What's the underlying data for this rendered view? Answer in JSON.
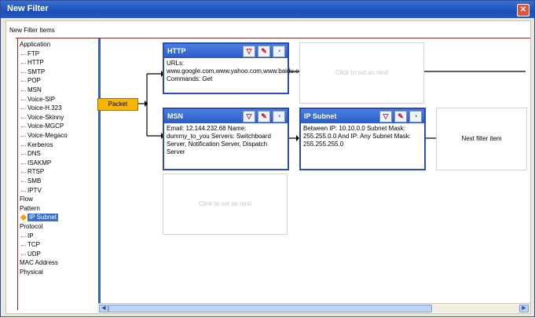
{
  "window": {
    "title": "New Filter",
    "close_glyph": "✕"
  },
  "panel": {
    "label": "New Filter Items"
  },
  "tree": [
    {
      "label": "Application",
      "level": 0
    },
    {
      "label": "FTP",
      "level": 1
    },
    {
      "label": "HTTP",
      "level": 1
    },
    {
      "label": "SMTP",
      "level": 1
    },
    {
      "label": "POP",
      "level": 1
    },
    {
      "label": "MSN",
      "level": 1
    },
    {
      "label": "Voice-SIP",
      "level": 1
    },
    {
      "label": "Voice-H.323",
      "level": 1
    },
    {
      "label": "Voice-Skinny",
      "level": 1
    },
    {
      "label": "Voice-MGCP",
      "level": 1
    },
    {
      "label": "Voice-Megaco",
      "level": 1
    },
    {
      "label": "Kerberos",
      "level": 1
    },
    {
      "label": "DNS",
      "level": 1
    },
    {
      "label": "ISAKMP",
      "level": 1
    },
    {
      "label": "RTSP",
      "level": 1
    },
    {
      "label": "SMB",
      "level": 1
    },
    {
      "label": "IPTV",
      "level": 1
    },
    {
      "label": "Flow",
      "level": 0
    },
    {
      "label": "Pattern",
      "level": 0
    },
    {
      "label": "IP Subnet",
      "level": 1,
      "selected": true
    },
    {
      "label": "Protocol",
      "level": 0
    },
    {
      "label": "IP",
      "level": 1
    },
    {
      "label": "TCP",
      "level": 1
    },
    {
      "label": "UDP",
      "level": 1
    },
    {
      "label": "MAC Address",
      "level": 0
    },
    {
      "label": "Physical",
      "level": 0
    }
  ],
  "packet": {
    "label": "Packet"
  },
  "cards": {
    "http": {
      "title": "HTTP",
      "body": "URLs: www.google.com,www.yahoo.com,www.baidu.com Commands: Get"
    },
    "msn": {
      "title": "MSN",
      "body": "Email: 12.144.232.68 Name: dummy_to_you Servers: Switchboard Server, Notification Server, Dispatch Server"
    },
    "ipsubnet": {
      "title": "IP Subnet",
      "body": "Between IP: 10.10.0.0 Subnet Mask: 255.255.0.0 And IP: Any Subnet Mask: 255.255.255.0"
    }
  },
  "placeholders": {
    "top": "Click to set as next",
    "bottom": "Click to set as next",
    "next": "Next filter item"
  },
  "icons": {
    "filter": "filter-icon",
    "edit": "edit-icon",
    "delete": "delete-icon"
  }
}
